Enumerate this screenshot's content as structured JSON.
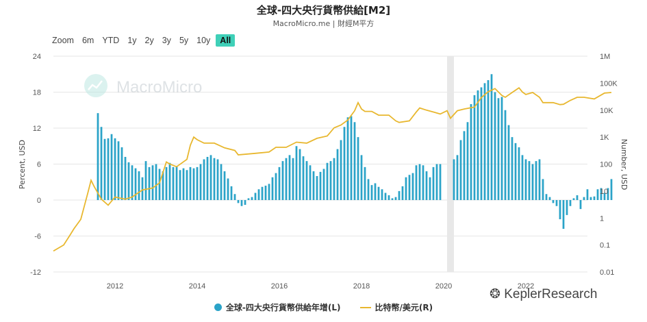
{
  "header": {
    "title": "全球-四大央行貨幣供給[M2]",
    "subtitle": "MacroMicro.me | 財經M平方"
  },
  "range_buttons": [
    "Zoom",
    "6m",
    "YTD",
    "1y",
    "2y",
    "3y",
    "5y",
    "10y",
    "All"
  ],
  "range_active": "All",
  "watermark": {
    "brand": "MacroMicro",
    "corner": "KeplerResearch"
  },
  "colors": {
    "bars": "#2aa3c8",
    "line": "#e8b72e",
    "shade": "#e8e8e8",
    "grid": "#e6e6e6",
    "watermark": "#c4cbd0"
  },
  "chart_data": {
    "type": "bar+line",
    "left_axis": {
      "label": "Percent, USD",
      "range": [
        -12,
        24
      ],
      "ticks": [
        "24",
        "18",
        "12",
        "6",
        "0",
        "-6",
        "-12"
      ]
    },
    "right_axis": {
      "label": "Number, USD",
      "scale": "log",
      "range": [
        0.01,
        1000000
      ],
      "ticks": [
        "1M",
        "100K",
        "10K",
        "1K",
        "100",
        "10",
        "1",
        "0.1",
        "0.01"
      ]
    },
    "x_axis": {
      "range": [
        "2010-07",
        "2023-07"
      ],
      "ticks": [
        "2012",
        "2014",
        "2016",
        "2018",
        "2020",
        "2022"
      ]
    },
    "shaded_period": [
      "2020-02",
      "2020-04"
    ],
    "grid": true,
    "legend_position": "bottom",
    "series": [
      {
        "name": "全球-四大央行貨幣供給年增(L)",
        "type": "bar",
        "axis": "left",
        "points": [
          [
            "2011-08",
            14.5
          ],
          [
            "2011-09",
            12.2
          ],
          [
            "2011-10",
            10.2
          ],
          [
            "2011-11",
            10.3
          ],
          [
            "2011-12",
            11.0
          ],
          [
            "2012-01",
            10.3
          ],
          [
            "2012-02",
            9.8
          ],
          [
            "2012-03",
            8.8
          ],
          [
            "2012-04",
            7.2
          ],
          [
            "2012-05",
            6.3
          ],
          [
            "2012-06",
            5.8
          ],
          [
            "2012-07",
            5.3
          ],
          [
            "2012-08",
            4.8
          ],
          [
            "2012-09",
            3.8
          ],
          [
            "2012-10",
            6.5
          ],
          [
            "2012-11",
            5.5
          ],
          [
            "2012-12",
            5.8
          ],
          [
            "2013-01",
            6.0
          ],
          [
            "2013-02",
            5.2
          ],
          [
            "2013-03",
            4.8
          ],
          [
            "2013-04",
            5.5
          ],
          [
            "2013-05",
            6.2
          ],
          [
            "2013-06",
            5.5
          ],
          [
            "2013-07",
            5.7
          ],
          [
            "2013-08",
            5.0
          ],
          [
            "2013-09",
            5.3
          ],
          [
            "2013-10",
            5.0
          ],
          [
            "2013-11",
            5.5
          ],
          [
            "2013-12",
            5.3
          ],
          [
            "2014-01",
            5.5
          ],
          [
            "2014-02",
            6.0
          ],
          [
            "2014-03",
            6.8
          ],
          [
            "2014-04",
            7.2
          ],
          [
            "2014-05",
            7.5
          ],
          [
            "2014-06",
            7.0
          ],
          [
            "2014-07",
            6.8
          ],
          [
            "2014-08",
            6.0
          ],
          [
            "2014-09",
            4.8
          ],
          [
            "2014-10",
            3.6
          ],
          [
            "2014-11",
            2.3
          ],
          [
            "2014-12",
            1.0
          ],
          [
            "2015-01",
            -0.5
          ],
          [
            "2015-02",
            -1.0
          ],
          [
            "2015-03",
            -0.8
          ],
          [
            "2015-04",
            0.3
          ],
          [
            "2015-05",
            0.5
          ],
          [
            "2015-06",
            1.2
          ],
          [
            "2015-07",
            1.8
          ],
          [
            "2015-08",
            2.2
          ],
          [
            "2015-09",
            2.4
          ],
          [
            "2015-10",
            2.7
          ],
          [
            "2015-11",
            3.8
          ],
          [
            "2015-12",
            4.5
          ],
          [
            "2016-01",
            5.5
          ],
          [
            "2016-02",
            6.5
          ],
          [
            "2016-03",
            7.0
          ],
          [
            "2016-04",
            7.5
          ],
          [
            "2016-05",
            7.0
          ],
          [
            "2016-06",
            9.0
          ],
          [
            "2016-07",
            8.5
          ],
          [
            "2016-08",
            7.3
          ],
          [
            "2016-09",
            6.5
          ],
          [
            "2016-10",
            5.8
          ],
          [
            "2016-11",
            4.8
          ],
          [
            "2016-12",
            4.0
          ],
          [
            "2017-01",
            4.7
          ],
          [
            "2017-02",
            5.2
          ],
          [
            "2017-03",
            6.2
          ],
          [
            "2017-04",
            6.5
          ],
          [
            "2017-05",
            7.0
          ],
          [
            "2017-06",
            8.5
          ],
          [
            "2017-07",
            10.0
          ],
          [
            "2017-08",
            12.2
          ],
          [
            "2017-09",
            13.8
          ],
          [
            "2017-10",
            14.0
          ],
          [
            "2017-11",
            13.0
          ],
          [
            "2017-12",
            10.5
          ],
          [
            "2018-01",
            7.5
          ],
          [
            "2018-02",
            5.5
          ],
          [
            "2018-03",
            3.5
          ],
          [
            "2018-04",
            2.5
          ],
          [
            "2018-05",
            2.8
          ],
          [
            "2018-06",
            2.2
          ],
          [
            "2018-07",
            1.8
          ],
          [
            "2018-08",
            1.2
          ],
          [
            "2018-09",
            0.8
          ],
          [
            "2018-10",
            0.3
          ],
          [
            "2018-11",
            0.5
          ],
          [
            "2018-12",
            1.5
          ],
          [
            "2019-01",
            2.3
          ],
          [
            "2019-02",
            3.8
          ],
          [
            "2019-03",
            4.2
          ],
          [
            "2019-04",
            4.5
          ],
          [
            "2019-05",
            5.8
          ],
          [
            "2019-06",
            6.0
          ],
          [
            "2019-07",
            5.8
          ],
          [
            "2019-08",
            4.8
          ],
          [
            "2019-09",
            3.8
          ],
          [
            "2019-10",
            5.5
          ],
          [
            "2019-11",
            6.0
          ],
          [
            "2019-12",
            6.0
          ],
          [
            "2020-04",
            6.8
          ],
          [
            "2020-05",
            7.5
          ],
          [
            "2020-06",
            10.0
          ],
          [
            "2020-07",
            11.5
          ],
          [
            "2020-08",
            13.0
          ],
          [
            "2020-09",
            16.0
          ],
          [
            "2020-10",
            17.5
          ],
          [
            "2020-11",
            18.3
          ],
          [
            "2020-12",
            18.8
          ],
          [
            "2021-01",
            19.5
          ],
          [
            "2021-02",
            20.0
          ],
          [
            "2021-03",
            21.0
          ],
          [
            "2021-04",
            18.0
          ],
          [
            "2021-05",
            17.0
          ],
          [
            "2021-06",
            17.2
          ],
          [
            "2021-07",
            15.0
          ],
          [
            "2021-08",
            12.5
          ],
          [
            "2021-09",
            10.5
          ],
          [
            "2021-10",
            9.5
          ],
          [
            "2021-11",
            8.8
          ],
          [
            "2021-12",
            7.5
          ],
          [
            "2022-01",
            6.8
          ],
          [
            "2022-02",
            6.5
          ],
          [
            "2022-03",
            6.0
          ],
          [
            "2022-04",
            6.5
          ],
          [
            "2022-05",
            6.8
          ],
          [
            "2022-06",
            3.5
          ],
          [
            "2022-07",
            1.0
          ],
          [
            "2022-08",
            0.5
          ],
          [
            "2022-09",
            -0.5
          ],
          [
            "2022-10",
            -1.0
          ],
          [
            "2022-11",
            -3.2
          ],
          [
            "2022-12",
            -4.8
          ],
          [
            "2023-01",
            -2.5
          ],
          [
            "2023-02",
            -1.0
          ],
          [
            "2023-03",
            0.3
          ],
          [
            "2023-04",
            0.8
          ],
          [
            "2023-05",
            -1.5
          ],
          [
            "2023-06",
            0.5
          ],
          [
            "2023-07",
            1.8
          ],
          [
            "2023-08",
            0.5
          ],
          [
            "2023-09",
            0.6
          ],
          [
            "2023-10",
            1.8
          ],
          [
            "2023-11",
            2.0
          ],
          [
            "2023-12",
            1.2
          ],
          [
            "2024-01",
            2.0
          ],
          [
            "2024-02",
            3.5
          ]
        ]
      },
      {
        "name": "比特幣/美元(R)",
        "type": "line",
        "axis": "right",
        "points": [
          [
            "2010-07",
            0.06
          ],
          [
            "2010-10",
            0.1
          ],
          [
            "2010-12",
            0.25
          ],
          [
            "2011-01",
            0.4
          ],
          [
            "2011-03",
            0.9
          ],
          [
            "2011-05",
            8
          ],
          [
            "2011-06",
            25
          ],
          [
            "2011-07",
            14
          ],
          [
            "2011-09",
            5
          ],
          [
            "2011-11",
            3
          ],
          [
            "2012-01",
            6
          ],
          [
            "2012-04",
            5
          ],
          [
            "2012-06",
            6
          ],
          [
            "2012-09",
            11
          ],
          [
            "2012-12",
            13
          ],
          [
            "2013-02",
            20
          ],
          [
            "2013-04",
            120
          ],
          [
            "2013-05",
            100
          ],
          [
            "2013-07",
            80
          ],
          [
            "2013-10",
            150
          ],
          [
            "2013-11",
            500
          ],
          [
            "2013-12",
            1000
          ],
          [
            "2014-01",
            800
          ],
          [
            "2014-03",
            600
          ],
          [
            "2014-06",
            600
          ],
          [
            "2014-09",
            400
          ],
          [
            "2014-12",
            320
          ],
          [
            "2015-01",
            220
          ],
          [
            "2015-06",
            250
          ],
          [
            "2015-10",
            280
          ],
          [
            "2015-12",
            420
          ],
          [
            "2016-03",
            420
          ],
          [
            "2016-06",
            650
          ],
          [
            "2016-09",
            600
          ],
          [
            "2016-12",
            900
          ],
          [
            "2017-03",
            1100
          ],
          [
            "2017-05",
            2200
          ],
          [
            "2017-07",
            2800
          ],
          [
            "2017-09",
            4300
          ],
          [
            "2017-11",
            9500
          ],
          [
            "2017-12",
            19000
          ],
          [
            "2018-01",
            11000
          ],
          [
            "2018-02",
            9000
          ],
          [
            "2018-04",
            9000
          ],
          [
            "2018-06",
            6500
          ],
          [
            "2018-09",
            6500
          ],
          [
            "2018-11",
            4000
          ],
          [
            "2018-12",
            3500
          ],
          [
            "2019-03",
            4000
          ],
          [
            "2019-05",
            8500
          ],
          [
            "2019-06",
            12000
          ],
          [
            "2019-08",
            10000
          ],
          [
            "2019-10",
            8500
          ],
          [
            "2019-12",
            7200
          ],
          [
            "2020-02",
            9500
          ],
          [
            "2020-03",
            5000
          ],
          [
            "2020-05",
            9500
          ],
          [
            "2020-07",
            11000
          ],
          [
            "2020-10",
            13000
          ],
          [
            "2020-12",
            29000
          ],
          [
            "2021-02",
            48000
          ],
          [
            "2021-04",
            63000
          ],
          [
            "2021-06",
            35000
          ],
          [
            "2021-07",
            30000
          ],
          [
            "2021-09",
            45000
          ],
          [
            "2021-11",
            67000
          ],
          [
            "2021-12",
            47000
          ],
          [
            "2022-01",
            38000
          ],
          [
            "2022-03",
            45000
          ],
          [
            "2022-05",
            30000
          ],
          [
            "2022-06",
            19000
          ],
          [
            "2022-09",
            19000
          ],
          [
            "2022-11",
            16000
          ],
          [
            "2022-12",
            16500
          ],
          [
            "2023-02",
            23000
          ],
          [
            "2023-04",
            30000
          ],
          [
            "2023-06",
            30000
          ],
          [
            "2023-09",
            26000
          ],
          [
            "2023-12",
            43000
          ],
          [
            "2024-02",
            45000
          ]
        ]
      }
    ]
  }
}
